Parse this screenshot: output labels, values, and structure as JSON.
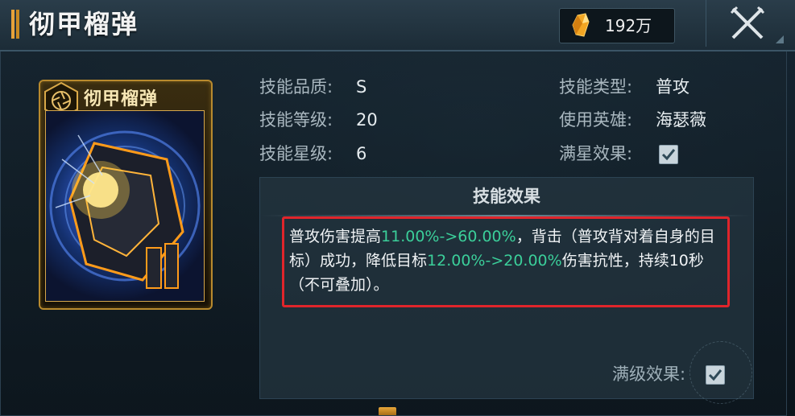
{
  "header": {
    "title": "彻甲榴弹",
    "currency": {
      "amount": "192万",
      "icon": "crystal-icon"
    },
    "close_icon": "close-icon"
  },
  "card": {
    "title": "彻甲榴弹",
    "badge_icon": "aperture-icon",
    "art": "armor-piercing-grenade-art"
  },
  "info": {
    "quality_label": "技能品质:",
    "quality_value": "S",
    "level_label": "技能等级:",
    "level_value": "20",
    "star_label": "技能星级:",
    "star_value": "6",
    "type_label": "技能类型:",
    "type_value": "普攻",
    "hero_label": "使用英雄:",
    "hero_value": "海瑟薇",
    "fullstar_label": "满星效果:",
    "fullstar_checked": true
  },
  "effect": {
    "title": "技能效果",
    "segments": [
      "普攻伤害提高",
      "11.00%->60.00%",
      "，背击（普攻背对着自身的目标）成功，降低目标",
      "12.00%->20.00%",
      "伤害抗性，持续10秒（不可叠加）。"
    ],
    "full_level_label": "满级效果:",
    "full_level_checked": true
  },
  "colors": {
    "highlight": "#3bcf9a",
    "annotation_box": "#e0252b",
    "gold": "#b88a2e"
  }
}
